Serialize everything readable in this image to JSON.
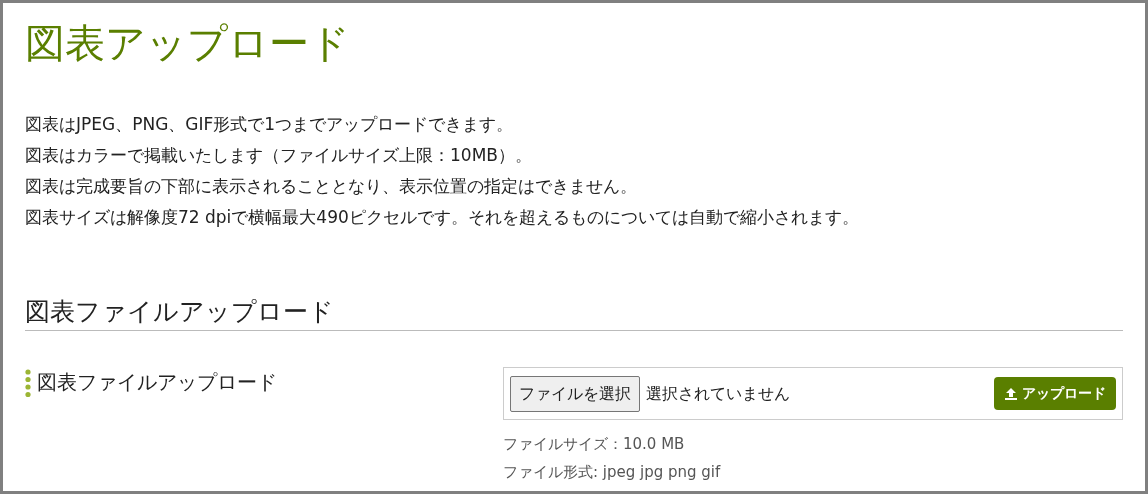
{
  "title": "図表アップロード",
  "notes": [
    "図表はJPEG、PNG、GIF形式で1つまでアップロードできます。",
    "図表はカラーで掲載いたします（ファイルサイズ上限：10MB）。",
    "図表は完成要旨の下部に表示されることとなり、表示位置の指定はできません。",
    "図表サイズは解像度72 dpiで横幅最大490ピクセルです。それを超えるものについては自動で縮小されます。"
  ],
  "section": {
    "heading": "図表ファイルアップロード",
    "field": {
      "label": "図表ファイルアップロード",
      "choose_button": "ファイルを選択",
      "file_status": "選択されていません",
      "upload_button": "アップロード",
      "hints": [
        "ファイルサイズ：10.0 MB",
        "ファイル形式: jpeg jpg png gif"
      ]
    }
  }
}
